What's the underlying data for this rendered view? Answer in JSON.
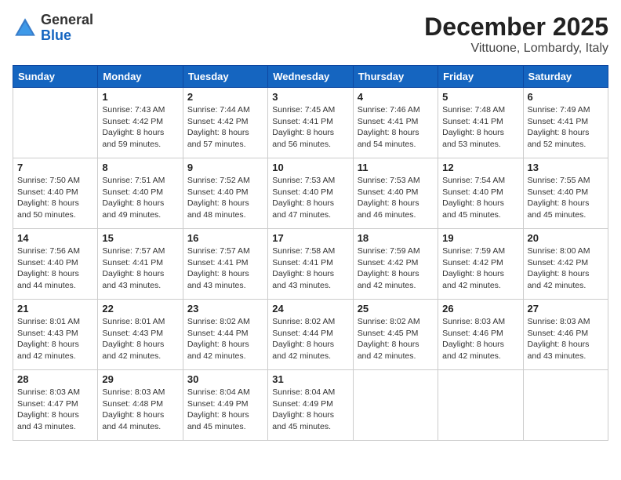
{
  "header": {
    "logo_general": "General",
    "logo_blue": "Blue",
    "title": "December 2025",
    "subtitle": "Vittuone, Lombardy, Italy"
  },
  "days_of_week": [
    "Sunday",
    "Monday",
    "Tuesday",
    "Wednesday",
    "Thursday",
    "Friday",
    "Saturday"
  ],
  "weeks": [
    [
      {
        "day": "",
        "sunrise": "",
        "sunset": "",
        "daylight": ""
      },
      {
        "day": "1",
        "sunrise": "Sunrise: 7:43 AM",
        "sunset": "Sunset: 4:42 PM",
        "daylight": "Daylight: 8 hours and 59 minutes."
      },
      {
        "day": "2",
        "sunrise": "Sunrise: 7:44 AM",
        "sunset": "Sunset: 4:42 PM",
        "daylight": "Daylight: 8 hours and 57 minutes."
      },
      {
        "day": "3",
        "sunrise": "Sunrise: 7:45 AM",
        "sunset": "Sunset: 4:41 PM",
        "daylight": "Daylight: 8 hours and 56 minutes."
      },
      {
        "day": "4",
        "sunrise": "Sunrise: 7:46 AM",
        "sunset": "Sunset: 4:41 PM",
        "daylight": "Daylight: 8 hours and 54 minutes."
      },
      {
        "day": "5",
        "sunrise": "Sunrise: 7:48 AM",
        "sunset": "Sunset: 4:41 PM",
        "daylight": "Daylight: 8 hours and 53 minutes."
      },
      {
        "day": "6",
        "sunrise": "Sunrise: 7:49 AM",
        "sunset": "Sunset: 4:41 PM",
        "daylight": "Daylight: 8 hours and 52 minutes."
      }
    ],
    [
      {
        "day": "7",
        "sunrise": "Sunrise: 7:50 AM",
        "sunset": "Sunset: 4:40 PM",
        "daylight": "Daylight: 8 hours and 50 minutes."
      },
      {
        "day": "8",
        "sunrise": "Sunrise: 7:51 AM",
        "sunset": "Sunset: 4:40 PM",
        "daylight": "Daylight: 8 hours and 49 minutes."
      },
      {
        "day": "9",
        "sunrise": "Sunrise: 7:52 AM",
        "sunset": "Sunset: 4:40 PM",
        "daylight": "Daylight: 8 hours and 48 minutes."
      },
      {
        "day": "10",
        "sunrise": "Sunrise: 7:53 AM",
        "sunset": "Sunset: 4:40 PM",
        "daylight": "Daylight: 8 hours and 47 minutes."
      },
      {
        "day": "11",
        "sunrise": "Sunrise: 7:53 AM",
        "sunset": "Sunset: 4:40 PM",
        "daylight": "Daylight: 8 hours and 46 minutes."
      },
      {
        "day": "12",
        "sunrise": "Sunrise: 7:54 AM",
        "sunset": "Sunset: 4:40 PM",
        "daylight": "Daylight: 8 hours and 45 minutes."
      },
      {
        "day": "13",
        "sunrise": "Sunrise: 7:55 AM",
        "sunset": "Sunset: 4:40 PM",
        "daylight": "Daylight: 8 hours and 45 minutes."
      }
    ],
    [
      {
        "day": "14",
        "sunrise": "Sunrise: 7:56 AM",
        "sunset": "Sunset: 4:40 PM",
        "daylight": "Daylight: 8 hours and 44 minutes."
      },
      {
        "day": "15",
        "sunrise": "Sunrise: 7:57 AM",
        "sunset": "Sunset: 4:41 PM",
        "daylight": "Daylight: 8 hours and 43 minutes."
      },
      {
        "day": "16",
        "sunrise": "Sunrise: 7:57 AM",
        "sunset": "Sunset: 4:41 PM",
        "daylight": "Daylight: 8 hours and 43 minutes."
      },
      {
        "day": "17",
        "sunrise": "Sunrise: 7:58 AM",
        "sunset": "Sunset: 4:41 PM",
        "daylight": "Daylight: 8 hours and 43 minutes."
      },
      {
        "day": "18",
        "sunrise": "Sunrise: 7:59 AM",
        "sunset": "Sunset: 4:42 PM",
        "daylight": "Daylight: 8 hours and 42 minutes."
      },
      {
        "day": "19",
        "sunrise": "Sunrise: 7:59 AM",
        "sunset": "Sunset: 4:42 PM",
        "daylight": "Daylight: 8 hours and 42 minutes."
      },
      {
        "day": "20",
        "sunrise": "Sunrise: 8:00 AM",
        "sunset": "Sunset: 4:42 PM",
        "daylight": "Daylight: 8 hours and 42 minutes."
      }
    ],
    [
      {
        "day": "21",
        "sunrise": "Sunrise: 8:01 AM",
        "sunset": "Sunset: 4:43 PM",
        "daylight": "Daylight: 8 hours and 42 minutes."
      },
      {
        "day": "22",
        "sunrise": "Sunrise: 8:01 AM",
        "sunset": "Sunset: 4:43 PM",
        "daylight": "Daylight: 8 hours and 42 minutes."
      },
      {
        "day": "23",
        "sunrise": "Sunrise: 8:02 AM",
        "sunset": "Sunset: 4:44 PM",
        "daylight": "Daylight: 8 hours and 42 minutes."
      },
      {
        "day": "24",
        "sunrise": "Sunrise: 8:02 AM",
        "sunset": "Sunset: 4:44 PM",
        "daylight": "Daylight: 8 hours and 42 minutes."
      },
      {
        "day": "25",
        "sunrise": "Sunrise: 8:02 AM",
        "sunset": "Sunset: 4:45 PM",
        "daylight": "Daylight: 8 hours and 42 minutes."
      },
      {
        "day": "26",
        "sunrise": "Sunrise: 8:03 AM",
        "sunset": "Sunset: 4:46 PM",
        "daylight": "Daylight: 8 hours and 42 minutes."
      },
      {
        "day": "27",
        "sunrise": "Sunrise: 8:03 AM",
        "sunset": "Sunset: 4:46 PM",
        "daylight": "Daylight: 8 hours and 43 minutes."
      }
    ],
    [
      {
        "day": "28",
        "sunrise": "Sunrise: 8:03 AM",
        "sunset": "Sunset: 4:47 PM",
        "daylight": "Daylight: 8 hours and 43 minutes."
      },
      {
        "day": "29",
        "sunrise": "Sunrise: 8:03 AM",
        "sunset": "Sunset: 4:48 PM",
        "daylight": "Daylight: 8 hours and 44 minutes."
      },
      {
        "day": "30",
        "sunrise": "Sunrise: 8:04 AM",
        "sunset": "Sunset: 4:49 PM",
        "daylight": "Daylight: 8 hours and 45 minutes."
      },
      {
        "day": "31",
        "sunrise": "Sunrise: 8:04 AM",
        "sunset": "Sunset: 4:49 PM",
        "daylight": "Daylight: 8 hours and 45 minutes."
      },
      {
        "day": "",
        "sunrise": "",
        "sunset": "",
        "daylight": ""
      },
      {
        "day": "",
        "sunrise": "",
        "sunset": "",
        "daylight": ""
      },
      {
        "day": "",
        "sunrise": "",
        "sunset": "",
        "daylight": ""
      }
    ]
  ]
}
